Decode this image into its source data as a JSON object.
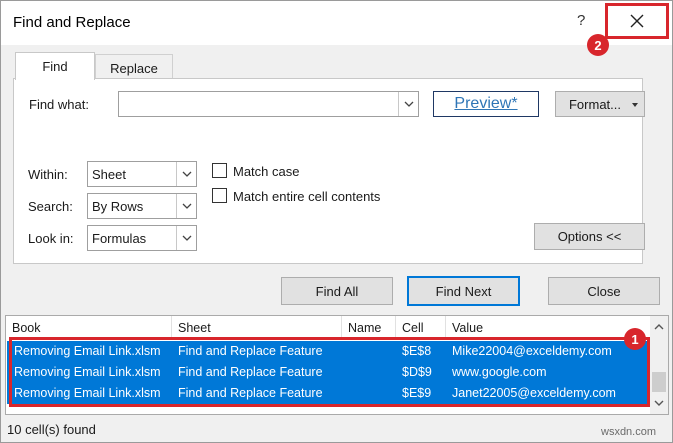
{
  "window": {
    "title": "Find and Replace",
    "help_label": "?",
    "close_glyph": "✕"
  },
  "annotations": {
    "marker_1": "1",
    "marker_2": "2"
  },
  "tabs": [
    {
      "label": "Find",
      "mnemonic_underline": "n",
      "active": true
    },
    {
      "label": "Replace",
      "mnemonic_underline": "p",
      "active": false
    }
  ],
  "find": {
    "label": "Find what:",
    "value": "",
    "preview_label": "Preview*",
    "format_label": "Format...",
    "within_label": "Within:",
    "within_value": "Sheet",
    "search_label": "Search:",
    "search_value": "By Rows",
    "lookin_label": "Look in:",
    "lookin_value": "Formulas",
    "match_case_label": "Match case",
    "match_case_checked": false,
    "match_entire_label": "Match entire cell contents",
    "match_entire_checked": false,
    "options_label": "Options <<"
  },
  "actions": {
    "find_all_label": "Find All",
    "find_next_label": "Find Next",
    "close_label": "Close"
  },
  "results": {
    "columns": [
      "Book",
      "Sheet",
      "Name",
      "Cell",
      "Value"
    ],
    "rows": [
      {
        "book": "Removing Email Link.xlsm",
        "sheet": "Find and Replace Feature",
        "name": "",
        "cell": "$E$8",
        "value": "Mike22004@exceldemy.com"
      },
      {
        "book": "Removing Email Link.xlsm",
        "sheet": "Find and Replace Feature",
        "name": "",
        "cell": "$D$9",
        "value": "www.google.com"
      },
      {
        "book": "Removing Email Link.xlsm",
        "sheet": "Find and Replace Feature",
        "name": "",
        "cell": "$E$9",
        "value": "Janet22005@exceldemy.com"
      }
    ]
  },
  "status": {
    "text": "10 cell(s) found"
  },
  "watermark": "wsxdn.com",
  "colors": {
    "selection": "#0078d7",
    "annotation_red": "#d8262c",
    "link_blue": "#2e75b6"
  }
}
